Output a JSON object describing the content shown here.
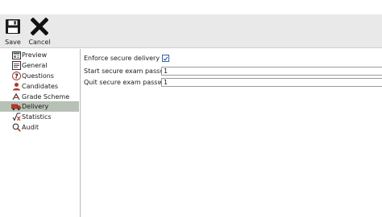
{
  "toolbar": {
    "save_label": "Save",
    "cancel_label": "Cancel",
    "save_icon": "floppy-disk-icon",
    "cancel_icon": "x-icon"
  },
  "sidebar": {
    "items": [
      {
        "label": "Preview",
        "icon": "preview-icon"
      },
      {
        "label": "General",
        "icon": "general-icon"
      },
      {
        "label": "Questions",
        "icon": "question-icon"
      },
      {
        "label": "Candidates",
        "icon": "candidates-icon"
      },
      {
        "label": "Grade Scheme",
        "icon": "grade-scheme-icon"
      },
      {
        "label": "Delivery",
        "icon": "delivery-icon",
        "selected": true
      },
      {
        "label": "Statistics",
        "icon": "statistics-icon"
      },
      {
        "label": "Audit",
        "icon": "audit-icon"
      }
    ]
  },
  "delivery": {
    "enforce_label": "Enforce secure delivery",
    "enforce_checked": true,
    "start_label": "Start secure exam password",
    "start_value": "1",
    "quit_label": "Quit secure exam password",
    "quit_value": "1"
  },
  "colors": {
    "selected_row": "#b8c1b6",
    "toolbar_bg": "#e9e9e9",
    "checkbox_border": "#3a62a8"
  }
}
